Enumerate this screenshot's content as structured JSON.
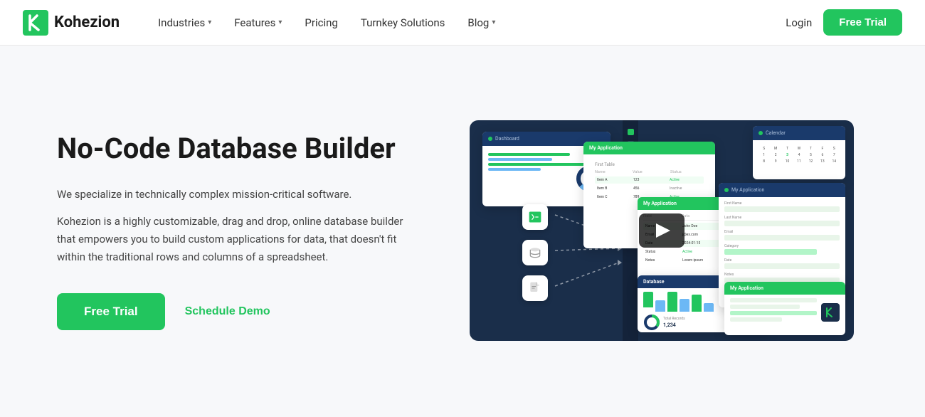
{
  "brand": {
    "name": "Kohezion",
    "logo_alt": "Kohezion logo"
  },
  "navbar": {
    "items": [
      {
        "label": "Industries",
        "has_dropdown": true
      },
      {
        "label": "Features",
        "has_dropdown": true
      },
      {
        "label": "Pricing",
        "has_dropdown": false
      },
      {
        "label": "Turnkey Solutions",
        "has_dropdown": false
      },
      {
        "label": "Blog",
        "has_dropdown": true
      }
    ],
    "login_label": "Login",
    "cta_label": "Free Trial"
  },
  "hero": {
    "title": "No-Code Database Builder",
    "description_1": "We specialize in technically complex mission-critical software.",
    "description_2": "Kohezion is a highly customizable, drag and drop, online database builder that empowers you to build custom applications for data, that doesn't fit within the traditional rows and columns of a spreadsheet.",
    "cta_primary": "Free Trial",
    "cta_secondary": "Schedule Demo"
  },
  "mockup": {
    "app_label": "My Application",
    "play_button_label": "Play video"
  },
  "colors": {
    "green": "#22c55e",
    "dark_navy": "#1a2e4a",
    "navy": "#1a3a6b"
  }
}
